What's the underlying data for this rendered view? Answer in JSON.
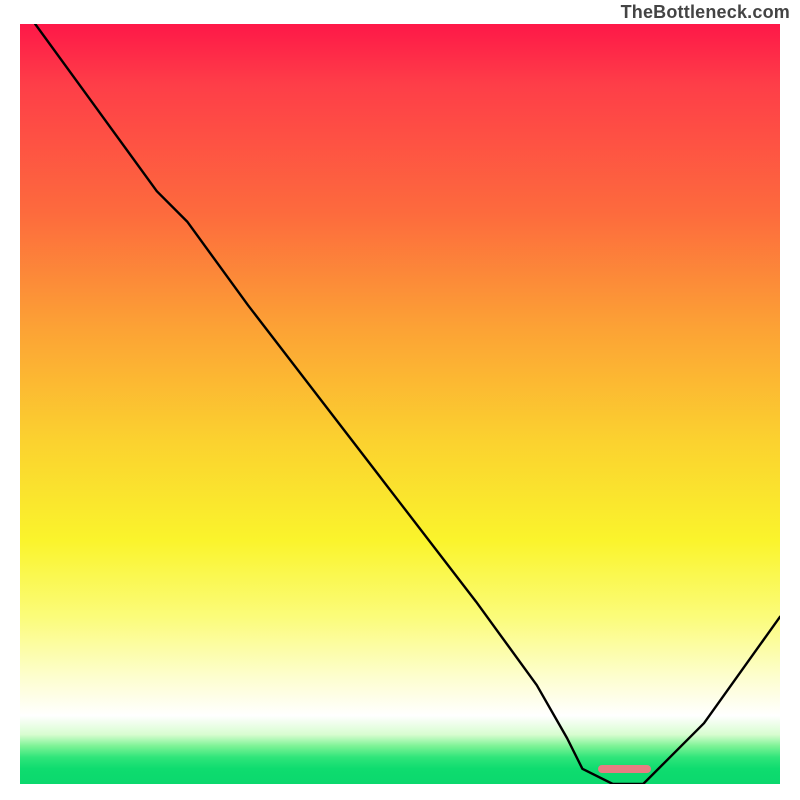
{
  "watermark": "TheBottleneck.com",
  "chart_data": {
    "type": "line",
    "title": "",
    "xlabel": "",
    "ylabel": "",
    "xlim": [
      0,
      100
    ],
    "ylim": [
      0,
      100
    ],
    "series": [
      {
        "name": "bottleneck-curve",
        "x": [
          2,
          10,
          18,
          22,
          30,
          40,
          50,
          60,
          68,
          72,
          74,
          78,
          82,
          90,
          100
        ],
        "values": [
          100,
          89,
          78,
          74,
          63,
          50,
          37,
          24,
          13,
          6,
          2,
          0,
          0,
          8,
          22
        ]
      }
    ],
    "optimal_marker": {
      "x_start": 76,
      "x_end": 83,
      "y": 2
    },
    "gradient_stops": [
      {
        "pos": 0,
        "color": "#fe1848"
      },
      {
        "pos": 0.55,
        "color": "#fbd22f"
      },
      {
        "pos": 0.91,
        "color": "#ffffff"
      },
      {
        "pos": 1.0,
        "color": "#0bd86d"
      }
    ]
  }
}
